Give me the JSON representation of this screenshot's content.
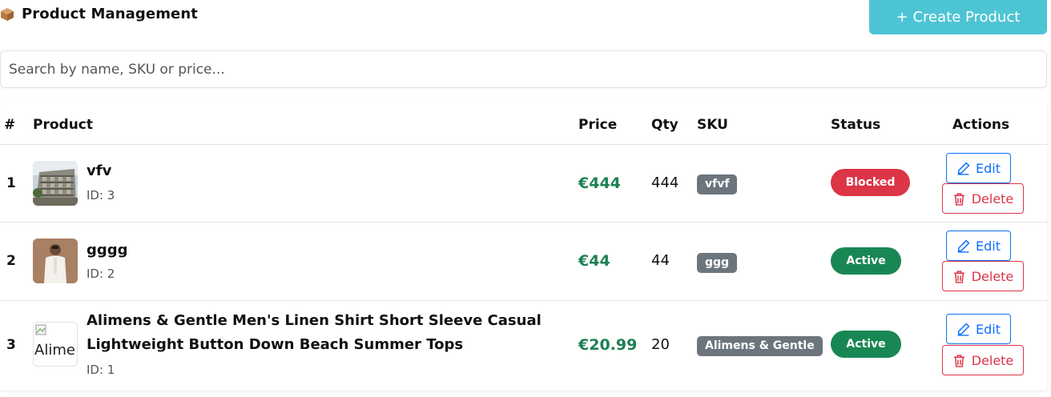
{
  "header": {
    "title": "Product Management",
    "title_icon": "package-icon",
    "create_label": "+ Create Product"
  },
  "search": {
    "placeholder": "Search by name, SKU or price..."
  },
  "table": {
    "columns": [
      "#",
      "Product",
      "Price",
      "Qty",
      "SKU",
      "Status",
      "Actions"
    ],
    "rows": [
      {
        "num": "1",
        "name": "vfv",
        "id_text": "ID: 3",
        "price": "€444",
        "qty": "444",
        "sku": "vfvf",
        "status": "Blocked",
        "image": "building-photo"
      },
      {
        "num": "2",
        "name": "gggg",
        "id_text": "ID: 2",
        "price": "€44",
        "qty": "44",
        "sku": "ggg",
        "status": "Active",
        "image": "man-in-white-shirt-photo"
      },
      {
        "num": "3",
        "name_line1": "Alimens & Gentle Men's Linen Shirt Short Sleeve Casual",
        "name_line2": "Lightweight Button Down Beach Summer Tops",
        "id_text": "ID: 1",
        "price": "€20.99",
        "qty": "20",
        "sku": "Alimens & Gentle",
        "status": "Active",
        "image_alt": "Alime"
      }
    ],
    "edit_label": "Edit",
    "delete_label": "Delete"
  },
  "colors": {
    "accent": "#4dc4d4",
    "price": "#1e8054",
    "blocked": "#dc3545",
    "active": "#198754",
    "edit": "#0d6efd",
    "badge": "#6c757d"
  }
}
